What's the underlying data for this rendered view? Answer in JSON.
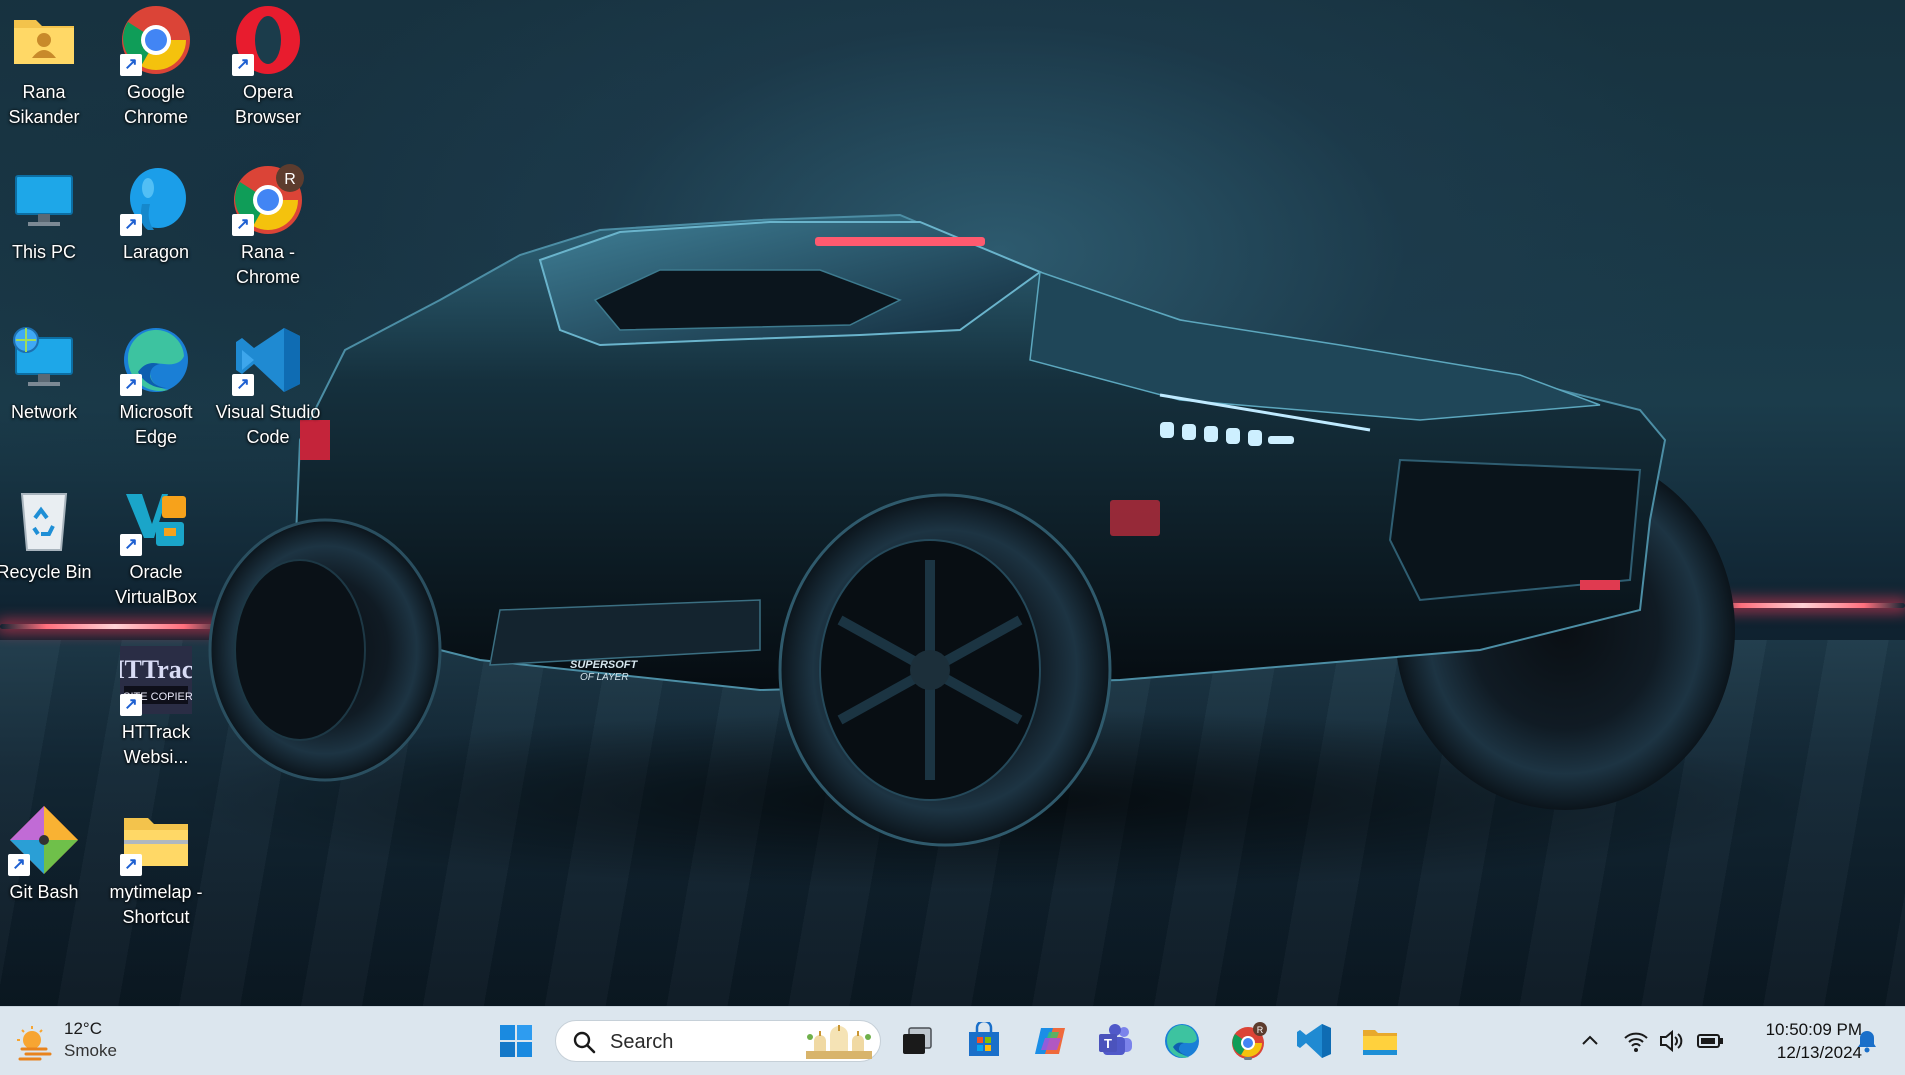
{
  "desktop": {
    "icons": [
      {
        "label": "Rana\nSikander",
        "l1": "Rana",
        "l2": "Sikander"
      },
      {
        "label": "Google Chrome",
        "l1": "Google",
        "l2": "Chrome"
      },
      {
        "label": "Opera Browser",
        "l1": "Opera",
        "l2": "Browser"
      },
      {
        "label": "This PC",
        "l1": "This PC",
        "l2": ""
      },
      {
        "label": "Laragon",
        "l1": "Laragon",
        "l2": ""
      },
      {
        "label": "Rana - Chrome",
        "l1": "Rana -",
        "l2": "Chrome",
        "badge": "R"
      },
      {
        "label": "Network",
        "l1": "Network",
        "l2": ""
      },
      {
        "label": "Microsoft Edge",
        "l1": "Microsoft",
        "l2": "Edge"
      },
      {
        "label": "Visual Studio Code",
        "l1": "Visual Studio",
        "l2": "Code"
      },
      {
        "label": "Recycle Bin",
        "l1": "Recycle Bin",
        "l2": ""
      },
      {
        "label": "Oracle VirtualBox",
        "l1": "Oracle",
        "l2": "VirtualBox"
      },
      {
        "label": "HTTrack Websi...",
        "l1": "HTTrack",
        "l2": "Websi...",
        "logo_text_1": "HTTrack",
        "logo_text_2": "SITE COPIER"
      },
      {
        "label": "Git Bash",
        "l1": "Git Bash",
        "l2": ""
      },
      {
        "label": "mytimelap - Shortcut",
        "l1": "mytimelap -",
        "l2": "Shortcut"
      }
    ]
  },
  "wallpaper": {
    "vehicle_text_1": "SUPERSOFT",
    "vehicle_text_2": "OF LAYER"
  },
  "taskbar": {
    "weather": {
      "temp": "12°C",
      "condition": "Smoke",
      "icon": "sun-haze-icon"
    },
    "search": {
      "placeholder": "Search"
    },
    "apps": [
      "start-icon",
      "task-view-icon",
      "store-icon",
      "copilot-icon",
      "teams-icon",
      "edge-icon",
      "chrome-icon",
      "vscode-icon",
      "file-explorer-icon"
    ],
    "chrome_badge": "R",
    "tray": [
      "chevron-up-icon",
      "wifi-icon",
      "volume-icon",
      "battery-icon"
    ],
    "clock": {
      "time": "10:50:09 PM",
      "date": "12/13/2024"
    },
    "notification_icon": "bell-icon"
  },
  "colors": {
    "taskbar_bg": "#dce6ee",
    "accent_blue": "#0078d4",
    "laser_red": "#ff6f7d"
  }
}
